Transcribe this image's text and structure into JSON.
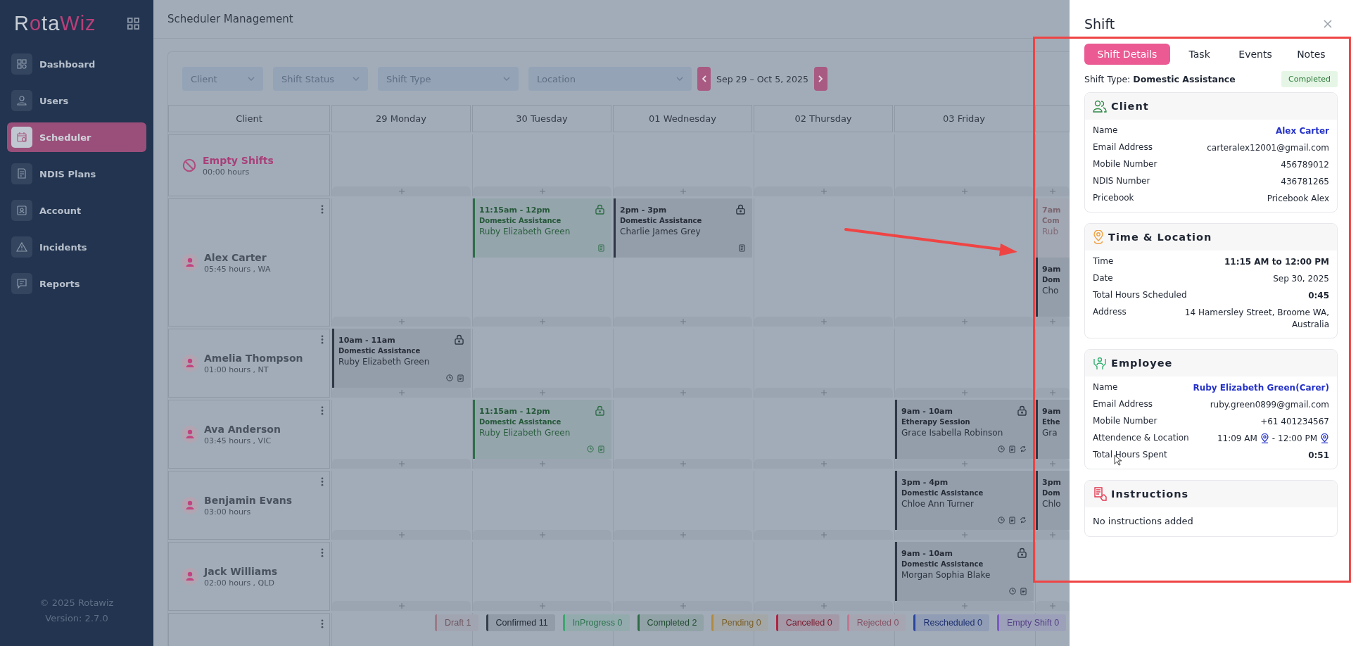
{
  "sidebar": {
    "logo": [
      "R",
      "o",
      "ta",
      "Wiz"
    ],
    "items": [
      {
        "label": "Dashboard",
        "selected": false
      },
      {
        "label": "Users",
        "selected": false
      },
      {
        "label": "Scheduler",
        "selected": true
      },
      {
        "label": "NDIS Plans",
        "selected": false
      },
      {
        "label": "Account",
        "selected": false
      },
      {
        "label": "Incidents",
        "selected": false
      },
      {
        "label": "Reports",
        "selected": false
      }
    ],
    "footer": [
      "© 2025 Rotawiz",
      "Version: 2.7.0"
    ]
  },
  "page": {
    "title": "Scheduler Management"
  },
  "filters": [
    {
      "placeholder": "Client"
    },
    {
      "placeholder": "Shift Status"
    },
    {
      "placeholder": "Shift Type"
    },
    {
      "placeholder": "Location"
    }
  ],
  "date_range": "Sep 29 – Oct 5, 2025",
  "schedule": {
    "header": {
      "client": "Client",
      "days": [
        "29 Monday",
        "30 Tuesday",
        "01 Wednesday",
        "02 Thursday",
        "03 Friday"
      ]
    },
    "rows": [
      {
        "kind": "empty",
        "name": "Empty Shifts",
        "hours": "00:00 hours",
        "cells": [
          {
            "kind": "empty"
          },
          {
            "kind": "empty"
          },
          {
            "kind": "empty"
          },
          {
            "kind": "empty"
          },
          {
            "kind": "empty"
          },
          {
            "kind": "empty"
          }
        ]
      },
      {
        "kind": "client",
        "name": "Alex Carter",
        "hours": "05:45 hours , WA",
        "cells": [
          {
            "kind": "empty"
          },
          {
            "kind": "shifts",
            "shifts": [
              {
                "color": "#2f6e48",
                "time": "11:15am - 12pm",
                "type": "Domestic Assistance",
                "employee": "Ruby Elizabeth Green",
                "locked": true,
                "clocked": false,
                "notes": true,
                "recurring": false
              }
            ]
          },
          {
            "kind": "shifts",
            "shifts": [
              {
                "color": "#2f3846",
                "time": "2pm - 3pm",
                "type": "Domestic Assistance",
                "employee": "Charlie James Grey",
                "locked": true,
                "clocked": false,
                "notes": true,
                "recurring": false
              }
            ]
          },
          {
            "kind": "empty"
          },
          {
            "kind": "empty"
          },
          {
            "kind": "shifts",
            "shifts": [
              {
                "color": "#9a7f8c",
                "time": "7am",
                "type": "Com",
                "employee": "Rub",
                "locked": false,
                "clocked": false,
                "notes": false,
                "recurring": false
              },
              {
                "color": "#2f3846",
                "time": "9am",
                "type": "Dom",
                "employee": "Cho",
                "locked": false,
                "clocked": false,
                "notes": false,
                "recurring": false
              }
            ]
          }
        ]
      },
      {
        "kind": "client",
        "name": "Amelia Thompson",
        "hours": "01:00 hours , NT",
        "cells": [
          {
            "kind": "shifts",
            "shifts": [
              {
                "color": "#2f3846",
                "time": "10am - 11am",
                "type": "Domestic Assistance",
                "employee": "Ruby Elizabeth Green",
                "locked": true,
                "clocked": true,
                "notes": true,
                "recurring": false
              }
            ]
          },
          {
            "kind": "empty"
          },
          {
            "kind": "empty"
          },
          {
            "kind": "empty"
          },
          {
            "kind": "empty"
          },
          {
            "kind": "empty"
          }
        ]
      },
      {
        "kind": "client",
        "name": "Ava Anderson",
        "hours": "03:45 hours , VIC",
        "cells": [
          {
            "kind": "empty"
          },
          {
            "kind": "shifts",
            "shifts": [
              {
                "color": "#2f6e48",
                "time": "11:15am - 12pm",
                "type": "Domestic Assistance",
                "employee": "Ruby Elizabeth Green",
                "locked": true,
                "clocked": true,
                "notes": true,
                "recurring": false
              }
            ]
          },
          {
            "kind": "empty"
          },
          {
            "kind": "empty"
          },
          {
            "kind": "shifts",
            "shifts": [
              {
                "color": "#2f3846",
                "time": "9am - 10am",
                "type": "Etherapy Session",
                "employee": "Grace Isabella Robinson",
                "locked": true,
                "clocked": true,
                "notes": true,
                "recurring": true
              }
            ]
          },
          {
            "kind": "shifts",
            "shifts": [
              {
                "color": "#2f3846",
                "time": "9am",
                "type": "Ethe",
                "employee": "Gra",
                "locked": false,
                "clocked": false,
                "notes": false,
                "recurring": false
              }
            ]
          }
        ]
      },
      {
        "kind": "client",
        "name": "Benjamin Evans",
        "hours": "03:00 hours",
        "cells": [
          {
            "kind": "empty"
          },
          {
            "kind": "empty"
          },
          {
            "kind": "empty"
          },
          {
            "kind": "empty"
          },
          {
            "kind": "shifts",
            "shifts": [
              {
                "color": "#2f3846",
                "time": "3pm - 4pm",
                "type": "Domestic Assistance",
                "employee": "Chloe Ann Turner",
                "locked": false,
                "clocked": true,
                "notes": true,
                "recurring": true
              }
            ]
          },
          {
            "kind": "shifts",
            "shifts": [
              {
                "color": "#2f3846",
                "time": "3pm",
                "type": "Dom",
                "employee": "Chlo",
                "locked": false,
                "clocked": false,
                "notes": false,
                "recurring": false
              }
            ]
          }
        ]
      },
      {
        "kind": "client",
        "name": "Jack Williams",
        "hours": "02:00 hours , QLD",
        "cells": [
          {
            "kind": "empty"
          },
          {
            "kind": "empty"
          },
          {
            "kind": "empty"
          },
          {
            "kind": "empty"
          },
          {
            "kind": "shifts",
            "shifts": [
              {
                "color": "#2f3846",
                "time": "9am - 10am",
                "type": "Domestic Assistance",
                "employee": "Morgan Sophia Blake",
                "locked": true,
                "clocked": true,
                "notes": true,
                "recurring": false
              }
            ]
          },
          {
            "kind": "empty"
          }
        ]
      }
    ]
  },
  "legend": [
    {
      "label": "Draft 1",
      "color": "#9b7b86"
    },
    {
      "label": "Confirmed 11",
      "color": "#333d4b"
    },
    {
      "label": "InProgress 0",
      "color": "#3fa670"
    },
    {
      "label": "Completed 2",
      "color": "#2e6b45"
    },
    {
      "label": "Pending 0",
      "color": "#b08a3e"
    },
    {
      "label": "Cancelled 0",
      "color": "#b0243f"
    },
    {
      "label": "Rejected 0",
      "color": "#c07890"
    },
    {
      "label": "Rescheduled 0",
      "color": "#2a44a0"
    },
    {
      "label": "Empty Shift 0",
      "color": "#7a5cc0"
    }
  ],
  "drawer": {
    "title": "Shift",
    "tabs": [
      {
        "label": "Shift Details",
        "selected": true
      },
      {
        "label": "Task",
        "selected": false
      },
      {
        "label": "Events",
        "selected": false
      },
      {
        "label": "Notes",
        "selected": false
      }
    ],
    "shift_type": {
      "label": "Shift Type:",
      "value": "Domestic Assistance"
    },
    "status": "Completed",
    "sections": [
      {
        "kind": "client",
        "title": "Client",
        "rows": [
          {
            "label": "Name",
            "value": "Alex Carter",
            "kind": "link"
          },
          {
            "label": "Email Address",
            "value": "carteralex12001@gmail.com",
            "kind": "plain"
          },
          {
            "label": "Mobile Number",
            "value": "456789012",
            "kind": "plain"
          },
          {
            "label": "NDIS Number",
            "value": "436781265",
            "kind": "plain"
          },
          {
            "label": "Pricebook",
            "value": "Pricebook Alex",
            "kind": "plain"
          }
        ]
      },
      {
        "kind": "location",
        "title": "Time & Location",
        "rows": [
          {
            "label": "Time",
            "value": "11:15 AM to 12:00 PM",
            "kind": "bold"
          },
          {
            "label": "Date",
            "value": "Sep 30, 2025",
            "kind": "plain"
          },
          {
            "label": "Total Hours Scheduled",
            "value": "0:45",
            "kind": "bold"
          },
          {
            "label": "Address",
            "value": "14 Hamersley Street, Broome WA, Australia",
            "kind": "plain"
          }
        ]
      },
      {
        "kind": "employee",
        "title": "Employee",
        "rows": [
          {
            "label": "Name",
            "value": "Ruby Elizabeth Green(Carer)",
            "kind": "link"
          },
          {
            "label": "Email Address",
            "value": "ruby.green0899@gmail.com",
            "kind": "plain"
          },
          {
            "label": "Mobile Number",
            "value": "+61 401234567",
            "kind": "plain"
          },
          {
            "label": "Attendence & Location",
            "kind": "attendance",
            "start": "11:09 AM",
            "end": "- 12:00 PM"
          },
          {
            "label": "Total Hours Spent",
            "value": "0:51",
            "kind": "bold"
          }
        ]
      },
      {
        "kind": "instructions",
        "title": "Instructions",
        "text": "No instructions added"
      }
    ]
  }
}
